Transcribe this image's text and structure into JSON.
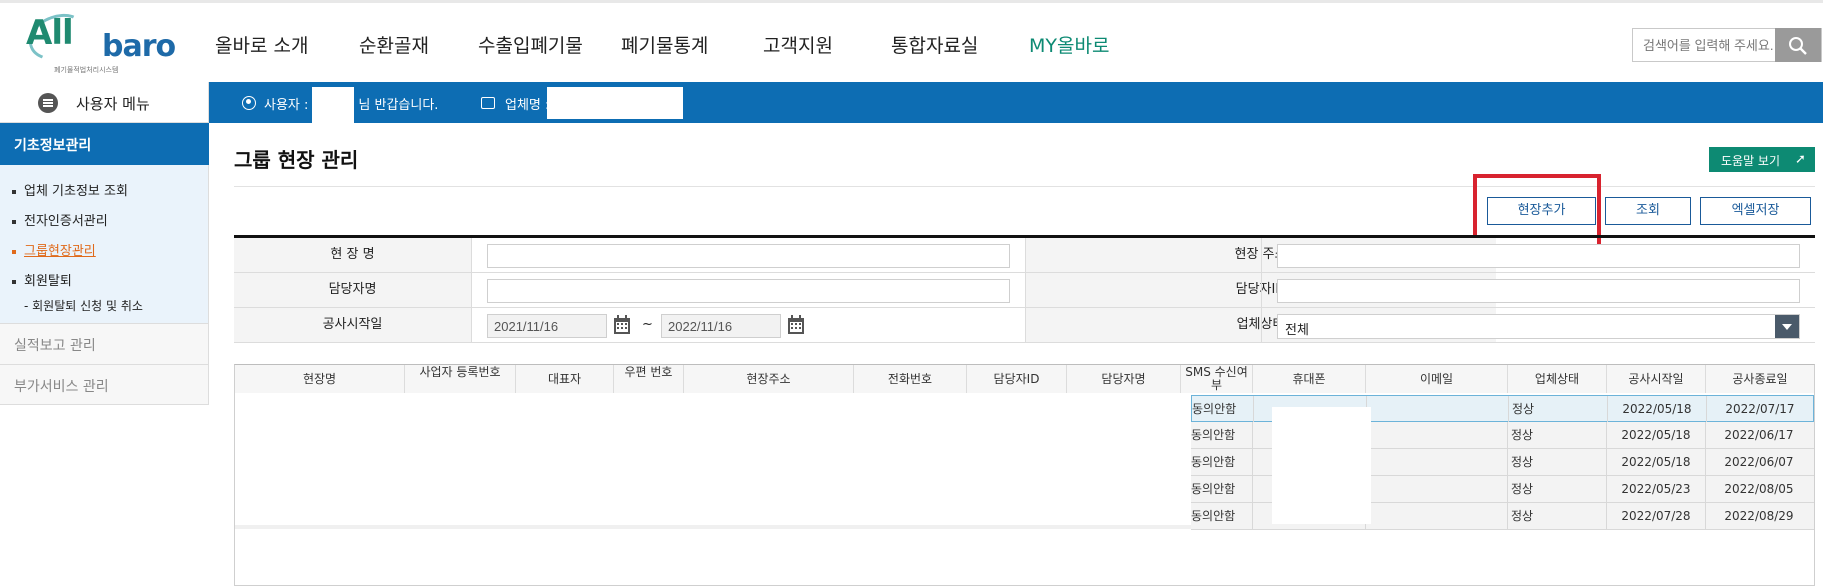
{
  "header": {
    "logo_text_1": "All",
    "logo_text_2": "baro",
    "logo_sub": "폐기물적법처리시스템",
    "nav": [
      {
        "label": "올바로 소개",
        "active": false
      },
      {
        "label": "순환골재",
        "active": false
      },
      {
        "label": "수출입폐기물",
        "active": false
      },
      {
        "label": "폐기물통계",
        "active": false
      },
      {
        "label": "고객지원",
        "active": false
      },
      {
        "label": "통합자료실",
        "active": false
      },
      {
        "label": "MY올바로",
        "active": true
      }
    ],
    "search_placeholder": "검색어를 입력해 주세요.",
    "accent_color": "#0d8a73"
  },
  "sidebar": {
    "menu_label": "사용자 메뉴",
    "section_title": "기초정보관리",
    "items": [
      {
        "label": "업체 기초정보 조회",
        "active": false
      },
      {
        "label": "전자인증서관리",
        "active": false
      },
      {
        "label": "그룹현장관리",
        "active": true
      },
      {
        "label": "회원탈퇴",
        "active": false
      }
    ],
    "sub_item": "- 회원탈퇴 신청 및 취소",
    "other_sections": [
      "실적보고 관리",
      "부가서비스 관리"
    ],
    "section_color": "#0d6db3"
  },
  "userbar": {
    "user_label": "사용자 :",
    "greeting": "님 반갑습니다.",
    "company_label": "업체명 :"
  },
  "main": {
    "title": "그룹 현장 관리",
    "help_button": "도움말 보기",
    "buttons": {
      "add": "현장추가",
      "search": "조회",
      "excel": "엑셀저장"
    }
  },
  "form": {
    "site_name_label": "현 장 명",
    "site_address_label": "현장 주소",
    "manager_name_label": "담당자명",
    "manager_id_label": "담당자ID",
    "start_date_label": "공사시작일",
    "start_date_from": "2021/11/16",
    "start_date_to": "2022/11/16",
    "date_separator": "~",
    "status_label": "업체상태",
    "status_value": "전체"
  },
  "grid": {
    "columns": [
      "현장명",
      "사업자 등록번호",
      "대표자",
      "우편 번호",
      "현장주소",
      "전화번호",
      "담당자ID",
      "담당자명",
      "SMS 수신여부",
      "휴대폰",
      "이메일",
      "업체상태",
      "공사시작일",
      "공사종료일"
    ],
    "rows": [
      {
        "sms": "동의안함",
        "phone": "",
        "email": "",
        "status": "정상",
        "start": "2022/05/18",
        "end": "2022/07/17",
        "selected": true
      },
      {
        "sms": "동의안함",
        "phone": "",
        "email": "",
        "status": "정상",
        "start": "2022/05/18",
        "end": "2022/06/17",
        "selected": false
      },
      {
        "sms": "동의안함",
        "phone": "",
        "email": "",
        "status": "정상",
        "start": "2022/05/18",
        "end": "2022/06/07",
        "selected": false
      },
      {
        "sms": "동의안함",
        "phone": "",
        "email": "",
        "status": "정상",
        "start": "2022/05/23",
        "end": "2022/08/05",
        "selected": false
      },
      {
        "sms": "동의안함",
        "phone": "",
        "email": "",
        "status": "정상",
        "start": "2022/07/28",
        "end": "2022/08/29",
        "selected": false
      }
    ]
  }
}
